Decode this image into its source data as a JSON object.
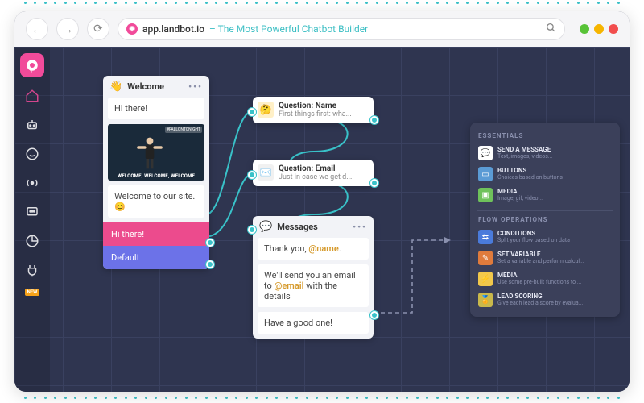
{
  "browser": {
    "host": "app.landbot.io",
    "tagline": "– The Most Powerful Chatbot Builder"
  },
  "sidebar": {
    "new_badge": "NEW"
  },
  "welcome_card": {
    "title": "Welcome",
    "msg1": "Hi there!",
    "gif_caption": "WELCOME, WELCOME, WELCOME",
    "gif_source": "#FALLONTONIGHT",
    "msg2": "Welcome to our site. 😊",
    "opt1": "Hi there!",
    "opt2": "Default"
  },
  "q_name": {
    "title": "Question: Name",
    "sub": "First things first: wha..."
  },
  "q_email": {
    "title": "Question: Email",
    "sub": "Just in case we get d..."
  },
  "messages_card": {
    "title": "Messages",
    "m1_pre": "Thank you, ",
    "m1_mention": "@name",
    "m1_post": ".",
    "m2_pre": "We'll send you an email to ",
    "m2_mention": "@email",
    "m2_post": " with the details",
    "m3": "Have a good one!"
  },
  "panel": {
    "sect1": "ESSENTIALS",
    "items1": [
      {
        "t": "SEND A MESSAGE",
        "d": "Text, images, videos..."
      },
      {
        "t": "BUTTONS",
        "d": "Choices based on buttons"
      },
      {
        "t": "MEDIA",
        "d": "Image, gif, video..."
      }
    ],
    "sect2": "FLOW OPERATIONS",
    "items2": [
      {
        "t": "CONDITIONS",
        "d": "Split your flow based on data"
      },
      {
        "t": "SET VARIABLE",
        "d": "Set a variable and perform calcul..."
      },
      {
        "t": "MEDIA",
        "d": "Use some pre-built functions to ..."
      },
      {
        "t": "LEAD SCORING",
        "d": "Give each lead a score by evalua..."
      }
    ]
  }
}
